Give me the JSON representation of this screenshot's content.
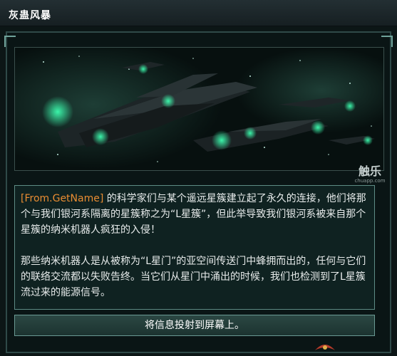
{
  "window": {
    "title": "灰蛊风暴"
  },
  "watermark": {
    "logo_text": "触乐",
    "url": "chuapp.com"
  },
  "event": {
    "scope_tag": "[From.GetName]",
    "paragraph_1_rest": " 的科学家们与某个遥远星簇建立起了永久的连接，他们将那个与我们银河系隔离的星簇称之为“L星簇”，但此举导致我们银河系被来自那个星簇的纳米机器人疯狂的入侵！",
    "paragraph_2": "那些纳米机器人是从被称为“L星门”的亚空间传送门中蜂拥而出的，任何与它们的联络交流都以失败告终。当它们从星门中涌出的时候，我们也检测到了L星簇流过来的能源信号。",
    "picture_icon": "nanite-fleet-image"
  },
  "options": [
    {
      "label": "将信息投射到屏幕上。"
    }
  ],
  "colors": {
    "scope_tag": "#e98c32",
    "body_text": "#e8ecec",
    "frame_border": "#5e8c85",
    "ship_glow": "#3dffb0"
  }
}
